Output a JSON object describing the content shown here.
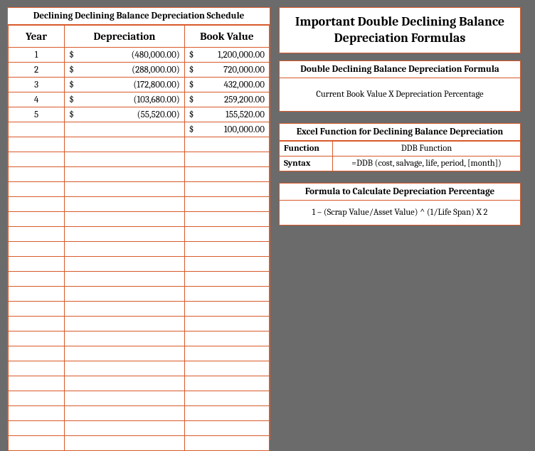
{
  "schedule": {
    "title": "Declining Declining Balance Depreciation Schedule",
    "headers": {
      "year": "Year",
      "depreciation": "Depreciation",
      "book_value": "Book Value"
    },
    "rows": [
      {
        "year": "1",
        "dep": "(480,000.00)",
        "bv": "1,200,000.00"
      },
      {
        "year": "2",
        "dep": "(288,000.00)",
        "bv": "720,000.00"
      },
      {
        "year": "3",
        "dep": "(172,800.00)",
        "bv": "432,000.00"
      },
      {
        "year": "4",
        "dep": "(103,680.00)",
        "bv": "259,200.00"
      },
      {
        "year": "5",
        "dep": "(55,520.00)",
        "bv": "155,520.00"
      }
    ],
    "final_bv": "100,000.00",
    "currency": "$",
    "empty_rows": 21
  },
  "formulas": {
    "main_title": "Important Double Declining Balance Depreciation Formulas",
    "ddb_formula_header": "Double Declining Balance Depreciation Formula",
    "ddb_formula_body": "Current Book Value X Depreciation Percentage",
    "excel_header": "Excel Function for Declining Balance Depreciation",
    "function_label": "Function",
    "function_value": "DDB Function",
    "syntax_label": "Syntax",
    "syntax_value": "=DDB (cost, salvage, life, period, [month])",
    "pct_header": "Formula to Calculate Depreciation Percentage",
    "pct_body": "1 – (Scrap Value/Asset Value) ^ (1/Life Span) X 2"
  }
}
